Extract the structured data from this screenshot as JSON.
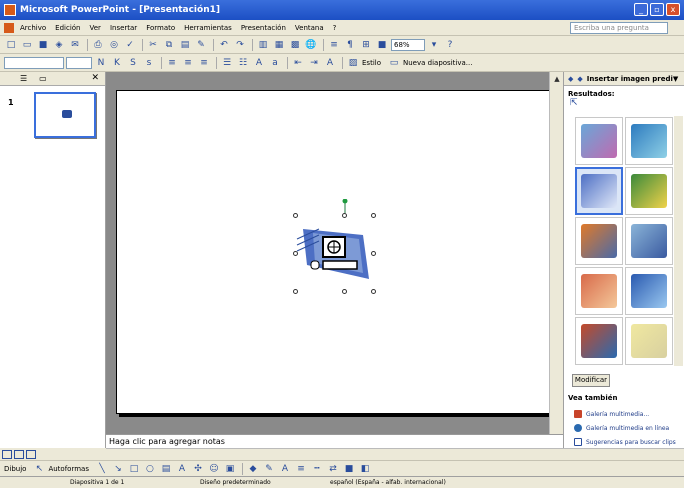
{
  "window": {
    "title": "Microsoft PowerPoint - [Presentación1]",
    "minimize_label": "_",
    "maximize_label": "▫",
    "close_label": "x"
  },
  "menubar": {
    "items": [
      "Archivo",
      "Edición",
      "Ver",
      "Insertar",
      "Formato",
      "Herramientas",
      "Presentación",
      "Ventana",
      "?"
    ],
    "ask_placeholder": "Escriba una pregunta"
  },
  "toolbar": {
    "zoom": "68%",
    "design_label": "Estilo",
    "new_slide_label": "Nueva diapositiva..."
  },
  "slides_pane": {
    "slide_number": "1"
  },
  "notes": {
    "placeholder": "Haga clic para agregar notas"
  },
  "task_pane": {
    "title": "Insertar imagen predi",
    "results_label": "Resultados:",
    "modify_button": "Modificar",
    "see_also_label": "Vea también",
    "links": [
      "Galería multimedia...",
      "Galería multimedia en línea",
      "Sugerencias para buscar clips"
    ]
  },
  "drawing_toolbar": {
    "draw_label": "Dibujo",
    "autoshapes_label": "Autoformas"
  },
  "statusbar": {
    "slide_info": "Diapositiva 1 de 1",
    "design": "Diseño predeterminado",
    "language": "español (España - alfab. internacional)"
  }
}
